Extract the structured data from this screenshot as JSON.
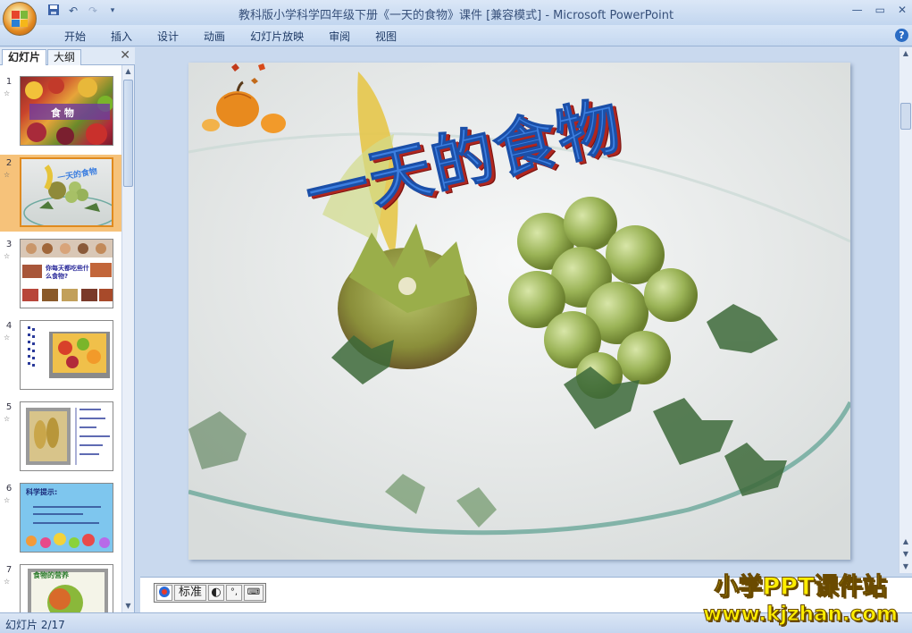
{
  "window": {
    "title": "教科版小学科学四年级下册《一天的食物》课件 [兼容模式] - Microsoft PowerPoint"
  },
  "ribbon": {
    "tabs": [
      "开始",
      "插入",
      "设计",
      "动画",
      "幻灯片放映",
      "审阅",
      "视图"
    ],
    "help": "?"
  },
  "pane": {
    "tabs": [
      "幻灯片",
      "大纲"
    ],
    "close": "✕",
    "slides": [
      {
        "num": "1",
        "label": "食  物"
      },
      {
        "num": "2",
        "label": "一天的食物"
      },
      {
        "num": "3",
        "label": "你每天都吃些什么食物?"
      },
      {
        "num": "4",
        "label": ""
      },
      {
        "num": "5",
        "label": ""
      },
      {
        "num": "6",
        "label": "科学提示:"
      },
      {
        "num": "7",
        "label": "食物的营养"
      }
    ]
  },
  "slide": {
    "title": "一天的食物"
  },
  "ime": {
    "label": "标准"
  },
  "status": {
    "slide_counter": "幻灯片 2/17"
  },
  "watermark": {
    "line1": "小学PPT课件站",
    "line2": "www.kjzhan.com"
  },
  "colors": {
    "selected_thumb": "#f6c27a",
    "title_blue": "#3d7fe0",
    "title_shadow": "#b0261f",
    "watermark": "#ffee00"
  }
}
